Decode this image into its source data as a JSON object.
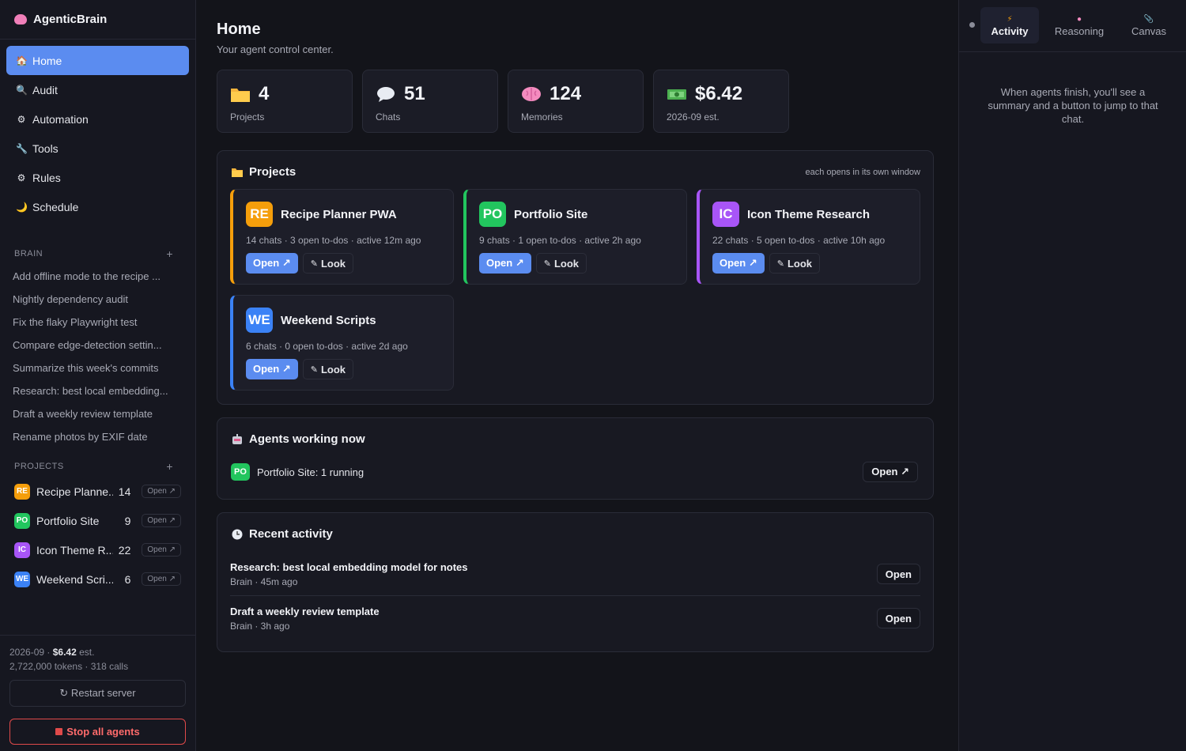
{
  "app": {
    "title": "AgenticBrain"
  },
  "nav": [
    {
      "label": "Home",
      "icon": "house-icon",
      "glyph": "🏠",
      "active": true
    },
    {
      "label": "Audit",
      "icon": "magnifier-icon",
      "glyph": "🔍"
    },
    {
      "label": "Automation",
      "icon": "gear-icon",
      "glyph": "⚙"
    },
    {
      "label": "Tools",
      "icon": "wrench-icon",
      "glyph": "🔧"
    },
    {
      "label": "Rules",
      "icon": "gear-icon",
      "glyph": "⚙"
    },
    {
      "label": "Schedule",
      "icon": "moon-icon",
      "glyph": "🌙"
    }
  ],
  "brain": {
    "heading": "BRAIN",
    "items": [
      "Add offline mode to the recipe ...",
      "Nightly dependency audit",
      "Fix the flaky Playwright test",
      "Compare edge-detection settin...",
      "Summarize this week's commits",
      "Research: best local embedding...",
      "Draft a weekly review template",
      "Rename photos by EXIF date"
    ]
  },
  "sidebar_projects": {
    "heading": "PROJECTS",
    "items": [
      {
        "badge": "RE",
        "color": "#f59e0b",
        "name": "Recipe Planne...",
        "count": "14",
        "open": "Open ↗"
      },
      {
        "badge": "PO",
        "color": "#22c55e",
        "name": "Portfolio Site",
        "count": "9",
        "open": "Open ↗"
      },
      {
        "badge": "IC",
        "color": "#a855f7",
        "name": "Icon Theme R...",
        "count": "22",
        "open": "Open ↗"
      },
      {
        "badge": "WE",
        "color": "#3b82f6",
        "name": "Weekend Scri...",
        "count": "6",
        "open": "Open ↗"
      }
    ]
  },
  "footer": {
    "month": "2026-09 ·",
    "cost": "$6.42",
    "cost_suffix": "est.",
    "usage": "2,722,000 tokens · 318 calls",
    "restart": "↻ Restart server",
    "stop": "Stop all agents"
  },
  "home": {
    "title": "Home",
    "subtitle": "Your agent control center."
  },
  "stats": [
    {
      "icon": "folder-icon",
      "value": "4",
      "label": "Projects"
    },
    {
      "icon": "speech-bubble-icon",
      "value": "51",
      "label": "Chats"
    },
    {
      "icon": "brain-icon",
      "value": "124",
      "label": "Memories"
    },
    {
      "icon": "money-icon",
      "value": "$6.42",
      "label": "2026-09 est."
    }
  ],
  "projects_panel": {
    "title": "Projects",
    "hint": "each opens in its own window",
    "cards": [
      {
        "badge": "RE",
        "color": "#f59e0b",
        "title": "Recipe Planner PWA",
        "meta": "14 chats · 3 open to-dos · active 12m ago",
        "open": "Open ↗",
        "look": "Look"
      },
      {
        "badge": "PO",
        "color": "#22c55e",
        "title": "Portfolio Site",
        "meta": "9 chats · 1 open to-dos · active 2h ago",
        "open": "Open ↗",
        "look": "Look"
      },
      {
        "badge": "IC",
        "color": "#a855f7",
        "title": "Icon Theme Research",
        "meta": "22 chats · 5 open to-dos · active 10h ago",
        "open": "Open ↗",
        "look": "Look"
      },
      {
        "badge": "WE",
        "color": "#3b82f6",
        "title": "Weekend Scripts",
        "meta": "6 chats · 0 open to-dos · active 2d ago",
        "open": "Open ↗",
        "look": "Look"
      }
    ]
  },
  "agents_panel": {
    "title": "Agents working now",
    "row": {
      "badge": "PO",
      "color": "#22c55e",
      "text": "Portfolio Site: 1 running",
      "open": "Open ↗"
    }
  },
  "activity_panel": {
    "title": "Recent activity",
    "items": [
      {
        "title": "Research: best local embedding model for notes",
        "meta": "Brain · 45m ago",
        "open": "Open"
      },
      {
        "title": "Draft a weekly review template",
        "meta": "Brain · 3h ago",
        "open": "Open"
      }
    ]
  },
  "right_panel": {
    "tabs": [
      {
        "label": "Activity",
        "icon": "lightning-icon",
        "active": true
      },
      {
        "label": "Reasoning",
        "icon": "brain-icon"
      },
      {
        "label": "Canvas",
        "icon": "paperclip-icon"
      }
    ],
    "empty": "When agents finish, you'll see a summary and a button to jump to that chat."
  },
  "colors": {
    "accent": "#5b8cf0",
    "danger": "#e04a4a",
    "bg": "#13141a"
  }
}
